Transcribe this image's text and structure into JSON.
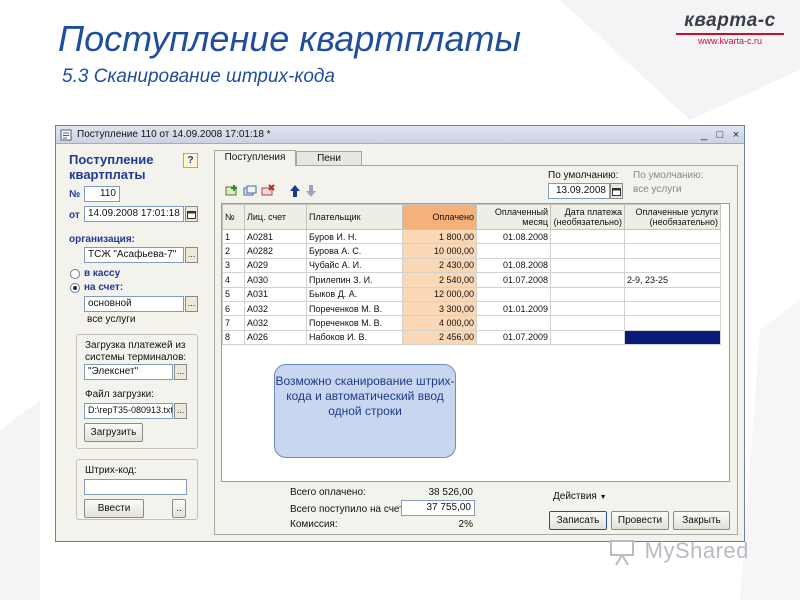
{
  "slide": {
    "title": "Поступление квартплаты",
    "subtitle": "5.3 Сканирование штрих-кода"
  },
  "brand": {
    "name": "кварта-с",
    "url": "www.kvarta-c.ru"
  },
  "window": {
    "title": "Поступление 110 от 14.09.2008 17:01:18 *",
    "controls": [
      "_",
      "□",
      "×"
    ]
  },
  "doc": {
    "heading": "Поступление квартплаты",
    "help": "?",
    "number_label": "№",
    "number": "110",
    "date_label": "от",
    "date": "14.09.2008 17:01:18",
    "org_label": "организация:",
    "org": "ТСЖ \"Асафьева-7\"",
    "radio_cash": "в кассу",
    "radio_account": "на счет:",
    "account": "основной",
    "services": "все услуги"
  },
  "terminal": {
    "label": "Загрузка платежей из системы терминалов:",
    "system": "\"Элекснет\"",
    "file_label": "Файл загрузки:",
    "file": "D:\\repT35-080913.txt",
    "load_button": "Загрузить"
  },
  "barcode": {
    "label": "Штрих-код:",
    "value": "",
    "enter_button": "Ввести",
    "more_button": ".."
  },
  "tabs": [
    {
      "label": "Поступления",
      "active": true
    },
    {
      "label": "Пени",
      "active": false
    }
  ],
  "defaults": {
    "label1": "По умолчанию:",
    "date": "13.09.2008",
    "label2": "По умолчанию:",
    "services": "все услуги"
  },
  "table": {
    "columns": [
      "№",
      "Лиц. счет",
      "Плательщик",
      "Оплачено",
      "Оплаченный месяц",
      "Дата платежа (необязательно)",
      "Оплаченные услуги (необязательно)"
    ],
    "rows": [
      [
        "1",
        "А0281",
        "Буров И. Н.",
        "1 800,00",
        "01.08.2008",
        "",
        ""
      ],
      [
        "2",
        "А0282",
        "Бурова А. С.",
        "10 000,00",
        "",
        "",
        ""
      ],
      [
        "3",
        "А029",
        "Чубайс А. И.",
        "2 430,00",
        "01.08.2008",
        "",
        ""
      ],
      [
        "4",
        "А030",
        "Прилепин З. И.",
        "2 540,00",
        "01.07.2008",
        "",
        "2-9, 23-25"
      ],
      [
        "5",
        "А031",
        "Быков Д. А.",
        "12 000,00",
        "",
        "",
        ""
      ],
      [
        "6",
        "А032",
        "Пореченков М. В.",
        "3 300,00",
        "01.01.2009",
        "",
        ""
      ],
      [
        "7",
        "А032",
        "Пореченков М. В.",
        "4 000,00",
        "",
        "",
        ""
      ],
      [
        "8",
        "А026",
        "Набоков И. В.",
        "2 456,00",
        "01.07.2009",
        "",
        ""
      ]
    ]
  },
  "callout": "Возможно сканирование штрих-кода и автоматический ввод одной строки",
  "totals": {
    "total_paid_label": "Всего оплачено:",
    "total_paid": "38 526,00",
    "total_received_label": "Всего поступило на счет:",
    "total_received": "37 755,00",
    "commission_label": "Комиссия:",
    "commission": "2%"
  },
  "actions": {
    "menu": "Действия",
    "save": "Записать",
    "post": "Провести",
    "close": "Закрыть"
  },
  "watermark": "MyShared"
}
